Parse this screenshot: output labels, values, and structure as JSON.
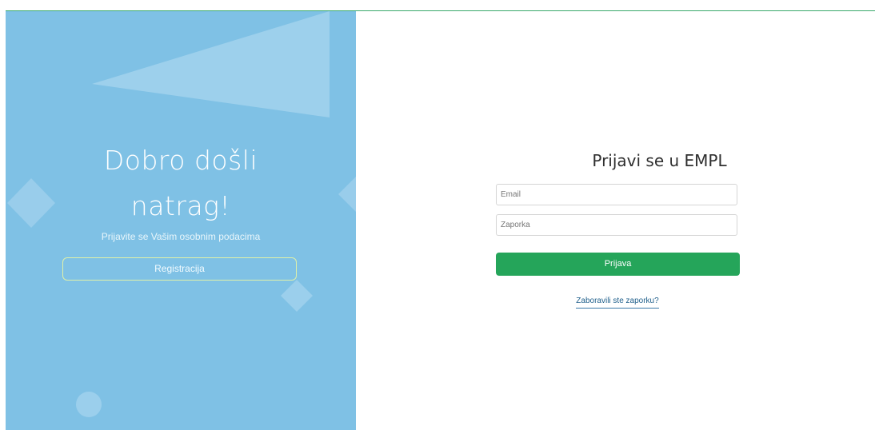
{
  "welcome": {
    "line1": "Dobro došli",
    "line2": "natrag!",
    "subtitle": "Prijavite se Vašim osobnim podacima",
    "register_label": "Registracija"
  },
  "login": {
    "title": "Prijavi se u EMPL",
    "email_placeholder": "Email",
    "password_placeholder": "Zaporka",
    "submit_label": "Prijava",
    "forgot_label": "Zaboravili ste zaporku?"
  },
  "colors": {
    "left_panel_bg": "#7fc1e5",
    "primary_button": "#25a55a",
    "link": "#1f5f8b",
    "accent_rule": "#3aa86b"
  },
  "decorations": [
    "triangle-shape",
    "diamond-shape",
    "diamond-shape",
    "diamond-shape",
    "circle-shape"
  ]
}
